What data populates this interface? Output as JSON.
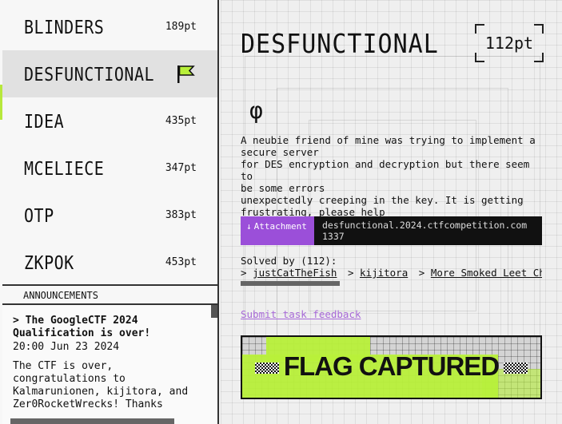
{
  "tasks": [
    {
      "name": "BLINDERS",
      "points": "189pt"
    },
    {
      "name": "DESFUNCTIONAL",
      "points": ""
    },
    {
      "name": "IDEA",
      "points": "435pt"
    },
    {
      "name": "MCELIECE",
      "points": "347pt"
    },
    {
      "name": "OTP",
      "points": "383pt"
    },
    {
      "name": "ZKPOK",
      "points": "453pt"
    }
  ],
  "announcements": {
    "header": "ANNOUNCEMENTS",
    "items": [
      {
        "title": "> The GoogleCTF 2024 Qualification is over!",
        "date": "20:00 Jun 23 2024",
        "text": "The CTF is over, congratulations to Kalmarunionen, kijitora, and Zer0RocketWrecks! Thanks"
      }
    ]
  },
  "task": {
    "title": "DESFUNCTIONAL",
    "points": "112pt",
    "category_symbol": "φ",
    "description": "A neubie friend of mine was trying to implement a\nsecure server\nfor DES encryption and decryption but there seem to\nbe some errors\nunexpectedly creeping in the key. It is getting\nfrustrating, please help",
    "attachment_label": "Attachment",
    "attachment_value": "desfunctional.2024.ctfcompetition.com\n1337",
    "solved_label": "Solved by (112):",
    "solvers": [
      "justCatTheFish",
      "kijitora",
      "More Smoked Leet Chicke"
    ],
    "feedback_link": "Submit task feedback",
    "captured_text": "FLAG CAPTURED"
  },
  "colors": {
    "accent_green": "#b8f03a",
    "attachment_purple": "#9b4fd9",
    "link_purple": "#a86ad8"
  }
}
